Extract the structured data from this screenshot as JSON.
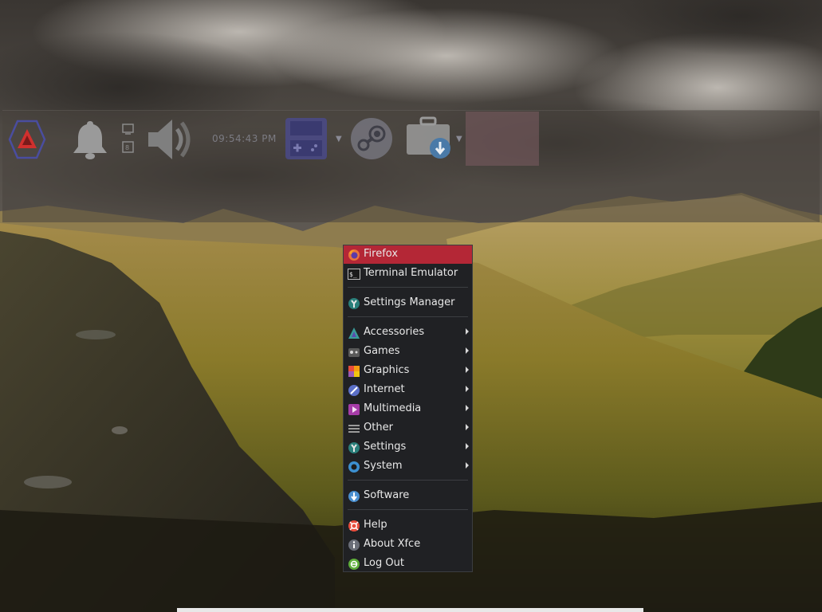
{
  "panel": {
    "clock": "09:54:43 PM",
    "launchers": [
      {
        "icon": "whisker-menu-icon"
      },
      {
        "icon": "notification-bell-icon"
      },
      {
        "icon": "network-indicator-icon"
      },
      {
        "icon": "volume-icon"
      },
      {
        "icon": "handheld-console-icon"
      },
      {
        "icon": "steam-icon"
      },
      {
        "icon": "software-store-icon"
      },
      {
        "icon": "window-thumbnail"
      }
    ]
  },
  "menu": {
    "items": [
      {
        "label": "Firefox",
        "icon": "firefox-icon",
        "submenu": false
      },
      {
        "label": "Terminal Emulator",
        "icon": "terminal-icon",
        "submenu": false
      },
      {
        "label": "Settings Manager",
        "icon": "settings-manager-icon",
        "submenu": false
      },
      {
        "label": "Accessories",
        "icon": "accessories-icon",
        "submenu": true
      },
      {
        "label": "Games",
        "icon": "games-icon",
        "submenu": true
      },
      {
        "label": "Graphics",
        "icon": "graphics-icon",
        "submenu": true
      },
      {
        "label": "Internet",
        "icon": "internet-icon",
        "submenu": true
      },
      {
        "label": "Multimedia",
        "icon": "multimedia-icon",
        "submenu": true
      },
      {
        "label": "Other",
        "icon": "other-icon",
        "submenu": true
      },
      {
        "label": "Settings",
        "icon": "settings-icon",
        "submenu": true
      },
      {
        "label": "System",
        "icon": "system-icon",
        "submenu": true
      },
      {
        "label": "Software",
        "icon": "software-icon",
        "submenu": false
      },
      {
        "label": "Help",
        "icon": "help-icon",
        "submenu": false
      },
      {
        "label": "About Xfce",
        "icon": "about-icon",
        "submenu": false
      },
      {
        "label": "Log Out",
        "icon": "logout-icon",
        "submenu": false
      }
    ],
    "active_item": "Firefox"
  },
  "colors": {
    "menu_bg": "#202124",
    "menu_highlight": "#b42736",
    "menu_text": "#e8e8e8",
    "panel_bg": "rgba(72,68,62,0.55)"
  }
}
